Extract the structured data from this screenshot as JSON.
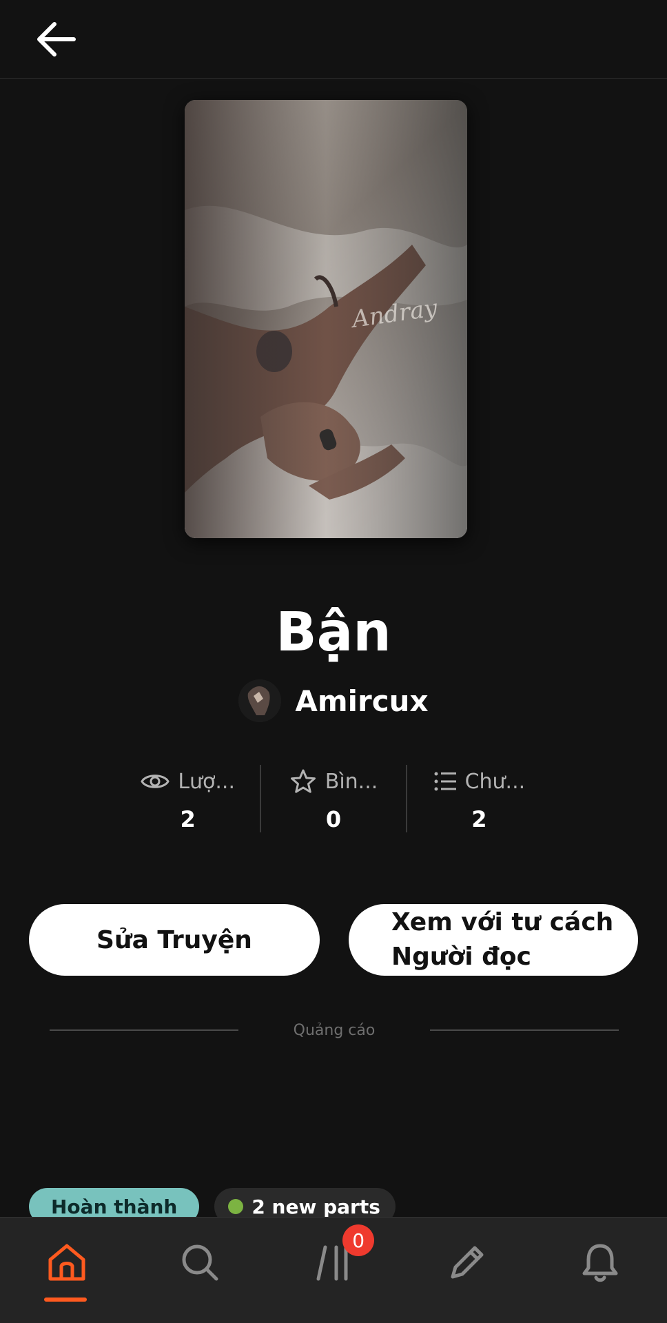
{
  "header": {
    "back_icon": "arrow-left-icon"
  },
  "story": {
    "title": "Bận",
    "author": "Amircux",
    "cover_watermark": "Andray"
  },
  "stats": [
    {
      "icon": "eye-icon",
      "label": "Lượ...",
      "value": "2"
    },
    {
      "icon": "star-icon",
      "label": "Bìn...",
      "value": "0"
    },
    {
      "icon": "list-icon",
      "label": "Chư...",
      "value": "2"
    }
  ],
  "actions": {
    "edit_label": "Sửa Truyện",
    "view_label_line1": "Xem với tư cách",
    "view_label_line2": "Người đọc"
  },
  "ad": {
    "label": "Quảng cáo"
  },
  "tags": {
    "status": "Hoàn thành",
    "new_parts": "2 new parts"
  },
  "nav": {
    "items": [
      "home-icon",
      "search-icon",
      "library-icon",
      "pencil-icon",
      "bell-icon"
    ],
    "library_badge": "0",
    "active_color": "#ff5a1f"
  }
}
